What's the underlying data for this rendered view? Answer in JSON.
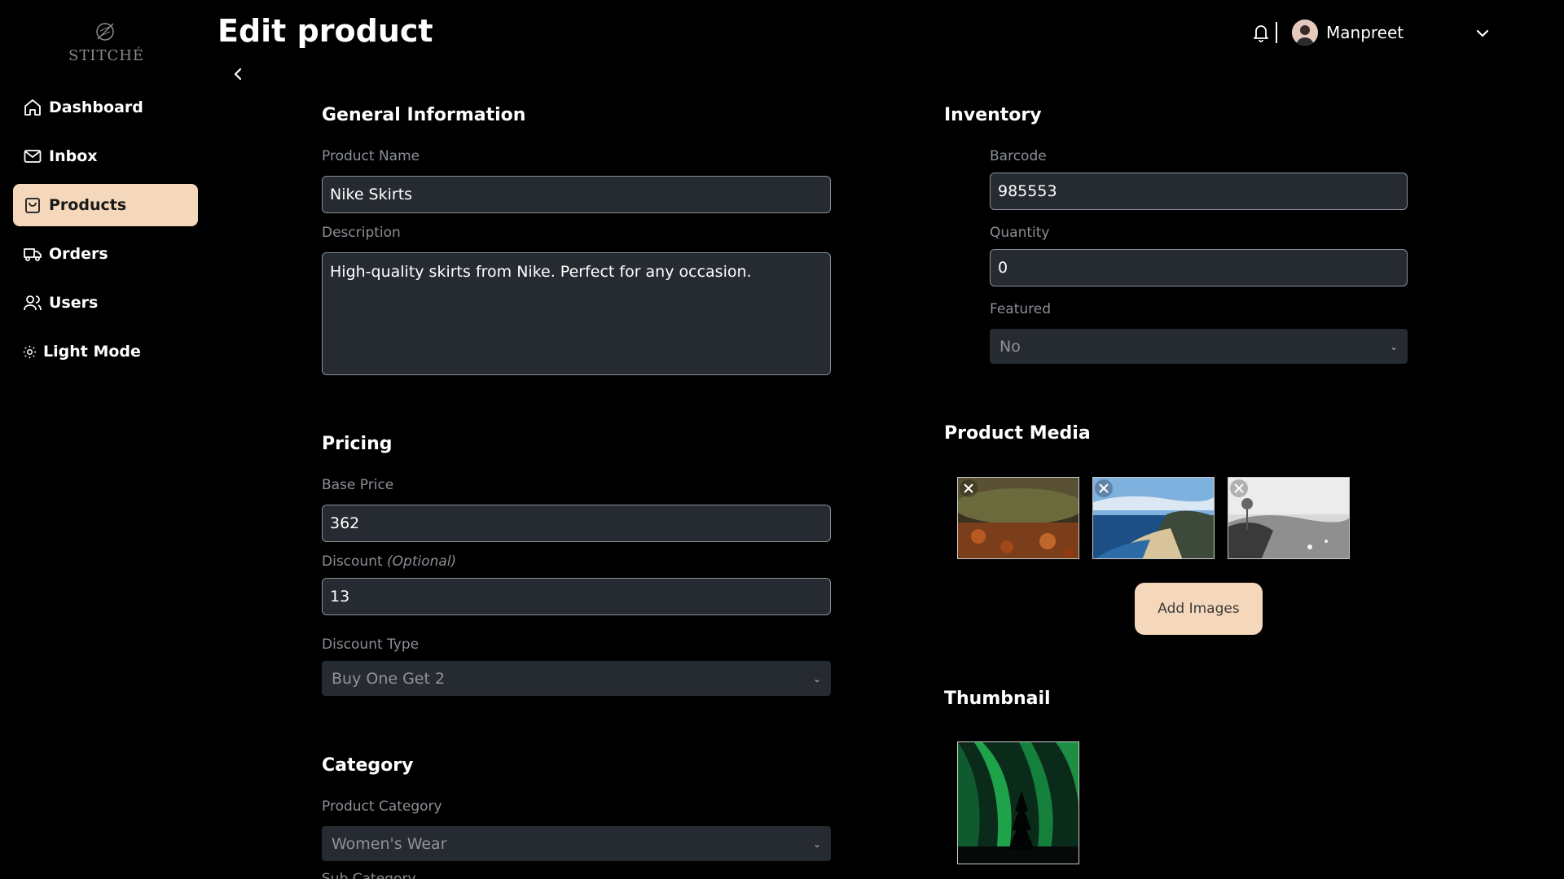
{
  "brand": {
    "name": "STITCHÉ"
  },
  "sidebar": {
    "items": [
      {
        "label": "Dashboard",
        "icon": "home-icon"
      },
      {
        "label": "Inbox",
        "icon": "mail-icon"
      },
      {
        "label": "Products",
        "icon": "shopping-bag-icon",
        "active": true
      },
      {
        "label": "Orders",
        "icon": "truck-icon"
      },
      {
        "label": "Users",
        "icon": "users-icon"
      },
      {
        "label": "Light Mode",
        "icon": "sun-icon"
      }
    ]
  },
  "header": {
    "title": "Edit product",
    "user_name": "Manpreet"
  },
  "general": {
    "title": "General Information",
    "name_label": "Product Name",
    "name_value": "Nike Skirts",
    "desc_label": "Description",
    "desc_value": "High-quality skirts from Nike. Perfect for any occasion."
  },
  "pricing": {
    "title": "Pricing",
    "base_label": "Base Price",
    "base_value": "362",
    "discount_label": "Discount",
    "discount_optional": "(Optional)",
    "discount_value": "13",
    "type_label": "Discount Type",
    "type_value": "Buy One Get 2"
  },
  "category": {
    "title": "Category",
    "cat_label": "Product Category",
    "cat_value": "Women's Wear",
    "sub_label": "Sub Category"
  },
  "inventory": {
    "title": "Inventory",
    "barcode_label": "Barcode",
    "barcode_value": "985553",
    "qty_label": "Quantity",
    "qty_value": "0",
    "featured_label": "Featured",
    "featured_value": "No"
  },
  "media": {
    "title": "Product Media",
    "add_label": "Add Images"
  },
  "thumbnail": {
    "title": "Thumbnail"
  },
  "colors": {
    "accent": "#f5d8bb",
    "field_bg": "#262a31",
    "label": "#8b8f96"
  }
}
